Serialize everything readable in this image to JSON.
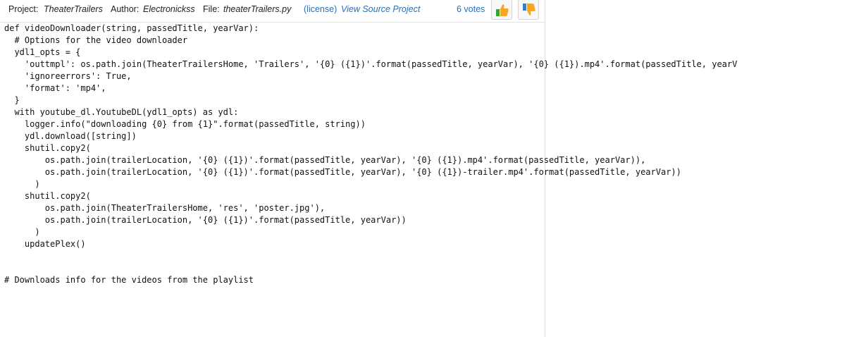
{
  "header": {
    "project_label": "Project:",
    "project_name": "TheaterTrailers",
    "author_label": "Author:",
    "author_name": "Electronickss",
    "file_label": "File:",
    "file_name": "theaterTrailers.py",
    "license_link": "(license)",
    "view_source_link": "View Source Project",
    "votes_text": "6 votes",
    "upvote_icon": "thumbs-up-icon",
    "downvote_icon": "thumbs-down-icon"
  },
  "code_lines": [
    "def videoDownloader(string, passedTitle, yearVar):",
    "  # Options for the video downloader",
    "  ydl1_opts = {",
    "    'outtmpl': os.path.join(TheaterTrailersHome, 'Trailers', '{0} ({1})'.format(passedTitle, yearVar), '{0} ({1}).mp4'.format(passedTitle, yearV",
    "    'ignoreerrors': True,",
    "    'format': 'mp4',",
    "  }",
    "  with youtube_dl.YoutubeDL(ydl1_opts) as ydl:",
    "    logger.info(\"downloading {0} from {1}\".format(passedTitle, string))",
    "    ydl.download([string])",
    "    shutil.copy2(",
    "        os.path.join(trailerLocation, '{0} ({1})'.format(passedTitle, yearVar), '{0} ({1}).mp4'.format(passedTitle, yearVar)),",
    "        os.path.join(trailerLocation, '{0} ({1})'.format(passedTitle, yearVar), '{0} ({1})-trailer.mp4'.format(passedTitle, yearVar))",
    "      )",
    "    shutil.copy2(",
    "        os.path.join(TheaterTrailersHome, 'res', 'poster.jpg'),",
    "        os.path.join(trailerLocation, '{0} ({1})'.format(passedTitle, yearVar))",
    "      )",
    "    updatePlex()",
    "",
    "",
    "# Downloads info for the videos from the playlist"
  ],
  "colors": {
    "link": "#2a6fb8",
    "thumb_up": "#f5a623",
    "thumb_down": "#f5a623",
    "thumb_green": "#3aa13a"
  }
}
